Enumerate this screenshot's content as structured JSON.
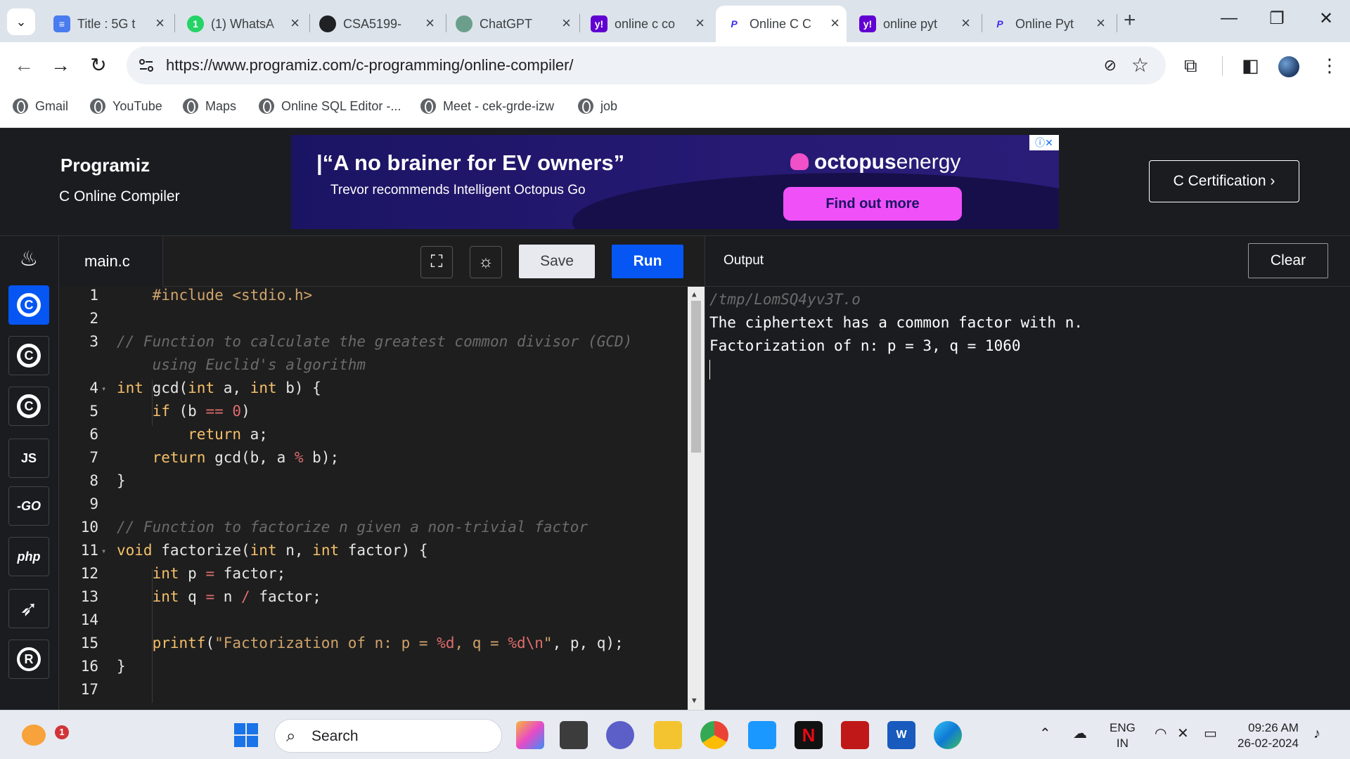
{
  "browser": {
    "tabs": [
      {
        "title": "Title : 5G t",
        "favicon": "docs-icon",
        "color": "#4a7cf0"
      },
      {
        "title": "(1) WhatsA",
        "favicon": "whatsapp-icon",
        "color": "#25d366",
        "fav_text": "1"
      },
      {
        "title": "CSA5199-",
        "favicon": "github-icon",
        "color": "#202124"
      },
      {
        "title": "ChatGPT",
        "favicon": "chatgpt-icon",
        "color": "#6b9f8c"
      },
      {
        "title": "online c co",
        "favicon": "yahoo-icon",
        "color": "#6001d2",
        "fav_text": "y!"
      },
      {
        "title": "Online C C",
        "favicon": "programiz-icon",
        "color": "#ffffff",
        "fav_text": "P",
        "active": true
      },
      {
        "title": "online pyt",
        "favicon": "yahoo-icon",
        "color": "#6001d2",
        "fav_text": "y!"
      },
      {
        "title": "Online Pyt",
        "favicon": "programiz-icon",
        "color": "#ffffff",
        "fav_text": "P"
      }
    ],
    "new_tab": "+",
    "window_controls": {
      "minimize": "—",
      "restore": "❐",
      "close": "✕"
    },
    "url": "https://www.programiz.com/c-programming/online-compiler/",
    "bookmarks": [
      "Gmail",
      "YouTube",
      "Maps",
      "Online SQL Editor -...",
      "Meet - cek-grde-izw",
      "job"
    ]
  },
  "site": {
    "logo": "Programiz",
    "subtitle": "C Online Compiler",
    "certification_button": "C Certification ›",
    "ad": {
      "headline": "|“A no brainer for EV owners”",
      "sub": "Trevor recommends Intelligent Octopus Go",
      "brand_bold": "octopus",
      "brand_light": "energy",
      "cta": "Find out more",
      "adchoices": "ⓘ✕"
    },
    "languages": [
      {
        "name": "java",
        "label": "♨"
      },
      {
        "name": "c",
        "label": "C",
        "active": true
      },
      {
        "name": "cpp",
        "label": "C"
      },
      {
        "name": "csharp",
        "label": "C"
      },
      {
        "name": "javascript",
        "label": "JS"
      },
      {
        "name": "go",
        "label": "-GO"
      },
      {
        "name": "php",
        "label": "php"
      },
      {
        "name": "swift",
        "label": "➶"
      },
      {
        "name": "rust",
        "label": "R"
      }
    ]
  },
  "editor": {
    "filename": "main.c",
    "save_label": "Save",
    "run_label": "Run",
    "line_numbers": [
      "1",
      "2",
      "3",
      "",
      "4",
      "5",
      "6",
      "7",
      "8",
      "9",
      "10",
      "11",
      "12",
      "13",
      "14",
      "15",
      "16",
      "17"
    ]
  },
  "output": {
    "title": "Output",
    "clear_label": "Clear",
    "lines": [
      "/tmp/LomSQ4yv3T.o",
      "The ciphertext has a common factor with n.",
      "Factorization of n: p = 3, q = 1060"
    ]
  },
  "taskbar": {
    "search_placeholder": "Search",
    "lang_top": "ENG",
    "lang_bottom": "IN",
    "time": "09:26 AM",
    "date": "26-02-2024",
    "notification_count": "1"
  }
}
